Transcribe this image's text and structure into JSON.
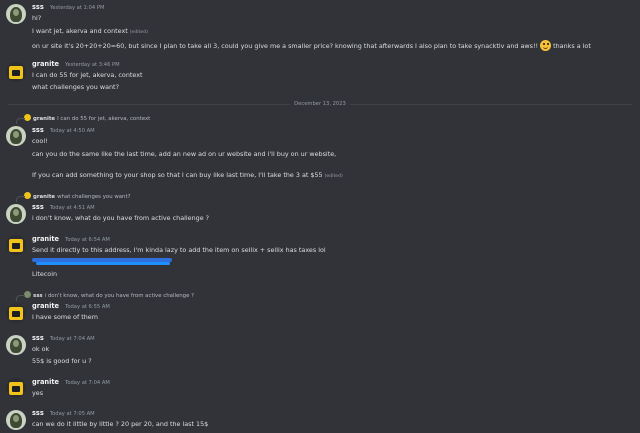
{
  "date_divider": "December 13, 2023",
  "messages": [
    {
      "user": "sss",
      "timestamp": "Yesterday at 1:04 PM",
      "lines": [
        "hi?",
        "I want jet, akerva and context",
        "on ur site it's 20+20+20=60, but since I plan to take all 3, could you give me a smaller price? knowing that afterwards I also plan to take synacktiv and aws!!",
        "thanks a lot"
      ],
      "edited": "(edited)"
    },
    {
      "user": "granite",
      "timestamp": "Yesterday at 3:46 PM",
      "lines": [
        "I can do 55 for jet, akerva, context",
        "what challenges you want?"
      ]
    },
    {
      "reply_user": "granite",
      "reply_text": "I can do 55 for jet, akerva, context",
      "user": "sss",
      "timestamp": "Today at 4:50 AM",
      "lines": [
        "cool!",
        "can you do the same like the last time, add an new ad on ur website and i'll buy on ur website,",
        "If you can add something to your shop so that I can buy like last time, I'll take the 3 at $55"
      ],
      "edited": "(edited)"
    },
    {
      "reply_user": "granite",
      "reply_text": "what challenges you want?",
      "user": "sss",
      "timestamp": "Today at 4:51 AM",
      "lines": [
        "i don't know, what do you have from active challenge ?"
      ]
    },
    {
      "user": "granite",
      "timestamp": "Today at 6:54 AM",
      "lines": [
        "Send it directly to this address, I'm kinda lazy to add the item on sellix + sellix has taxes lol",
        "Litecoin"
      ]
    },
    {
      "reply_user": "sss",
      "reply_text": "i don't know, what do you have from active challenge ?",
      "user": "granite",
      "timestamp": "Today at 6:55 AM",
      "lines": [
        "I have some of them"
      ]
    },
    {
      "user": "sss",
      "timestamp": "Today at 7:04 AM",
      "lines": [
        "ok ok",
        "55$ is good for u ?"
      ]
    },
    {
      "user": "granite",
      "timestamp": "Today at 7:04 AM",
      "lines": [
        "yes"
      ]
    },
    {
      "user": "sss",
      "timestamp": "Today at 7:05 AM",
      "lines": [
        "can we do it little by little ? 20 per 20, and the last 15$"
      ]
    }
  ]
}
